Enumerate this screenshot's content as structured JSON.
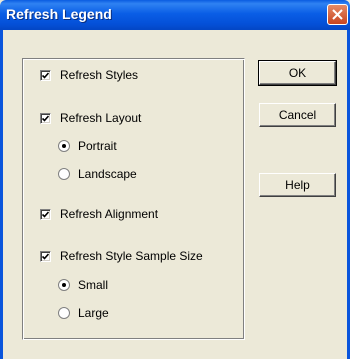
{
  "window": {
    "title": "Refresh Legend"
  },
  "options": {
    "refresh_styles": {
      "label": "Refresh Styles",
      "checked": true
    },
    "refresh_layout": {
      "label": "Refresh Layout",
      "checked": true
    },
    "layout_portrait": {
      "label": "Portrait",
      "selected": true
    },
    "layout_landscape": {
      "label": "Landscape",
      "selected": false
    },
    "refresh_alignment": {
      "label": "Refresh Alignment",
      "checked": true
    },
    "refresh_sample_size": {
      "label": "Refresh Style Sample Size",
      "checked": true
    },
    "size_small": {
      "label": "Small",
      "selected": true
    },
    "size_large": {
      "label": "Large",
      "selected": false
    }
  },
  "buttons": {
    "ok": "OK",
    "cancel": "Cancel",
    "help": "Help"
  }
}
